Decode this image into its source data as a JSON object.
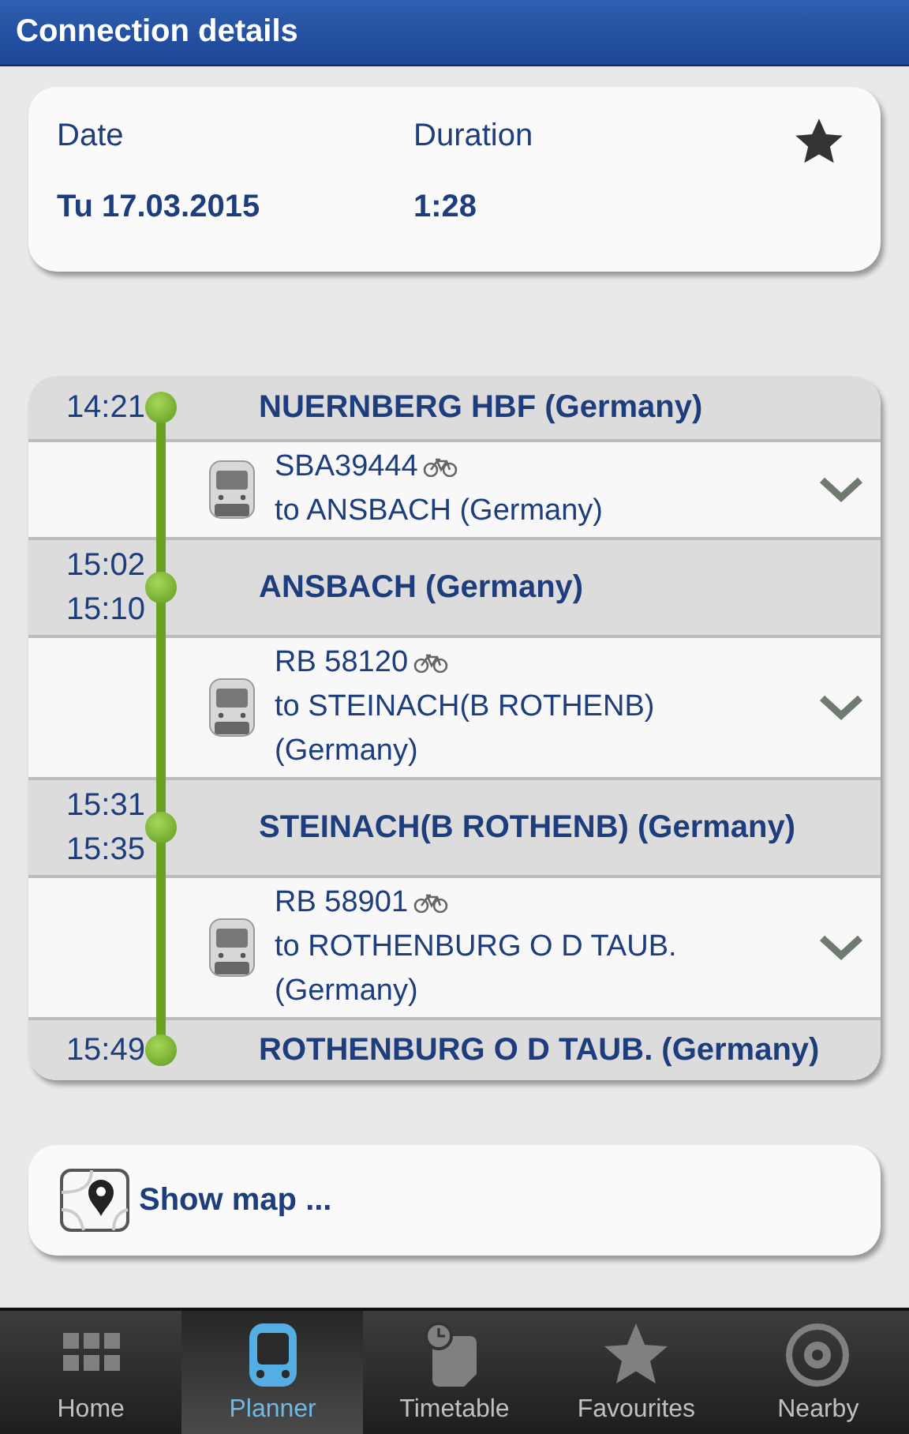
{
  "header": {
    "title": "Connection details"
  },
  "summary": {
    "date_label": "Date",
    "date": "Tu 17.03.2015",
    "duration_label": "Duration",
    "duration": "1:28"
  },
  "itinerary": [
    {
      "kind": "stop",
      "times": [
        "14:21"
      ],
      "name": "NUERNBERG HBF (Germany)"
    },
    {
      "kind": "leg",
      "train": "SBA39444",
      "bike": true,
      "destination": "to ANSBACH (Germany)",
      "expanded": false
    },
    {
      "kind": "stop",
      "times": [
        "15:02",
        "15:10"
      ],
      "name": "ANSBACH (Germany)"
    },
    {
      "kind": "leg",
      "train": "RB 58120",
      "bike": true,
      "destination": "to STEINACH(B ROTHENB) (Germany)",
      "expanded": false
    },
    {
      "kind": "stop",
      "times": [
        "15:31",
        "15:35"
      ],
      "name": "STEINACH(B ROTHENB) (Germany)"
    },
    {
      "kind": "leg",
      "train": "RB 58901",
      "bike": true,
      "destination": "to ROTHENBURG O D TAUB. (Germany)",
      "expanded": false
    },
    {
      "kind": "stop",
      "times": [
        "15:49"
      ],
      "name": "ROTHENBURG O D TAUB. (Germany)"
    }
  ],
  "map_button": {
    "label": "Show map ..."
  },
  "nav": [
    {
      "kind": "grid",
      "label": "Home",
      "selected": false
    },
    {
      "kind": "train",
      "label": "Planner",
      "selected": true
    },
    {
      "kind": "timetable",
      "label": "Timetable",
      "selected": false
    },
    {
      "kind": "star",
      "label": "Favourites",
      "selected": false
    },
    {
      "kind": "target",
      "label": "Nearby",
      "selected": false
    }
  ]
}
